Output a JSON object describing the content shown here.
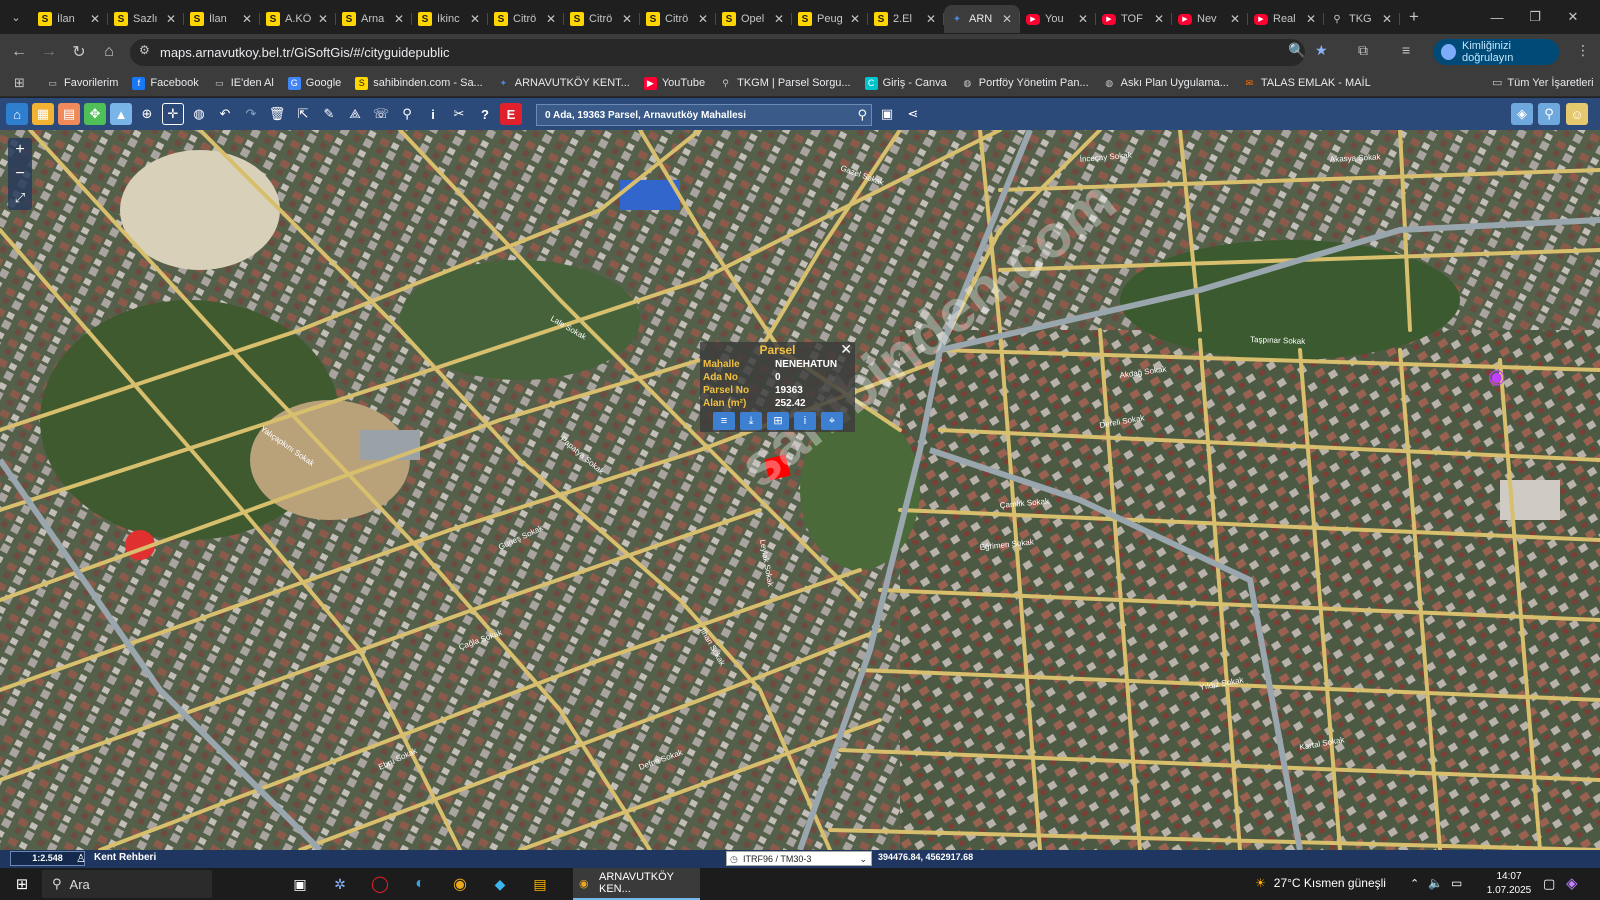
{
  "browser": {
    "tabs": [
      {
        "title": "İlan",
        "favicon": "sahibinden-icon"
      },
      {
        "title": "Sazlı",
        "favicon": "sahibinden-icon"
      },
      {
        "title": "İlan",
        "favicon": "sahibinden-icon"
      },
      {
        "title": "A.KÖ",
        "favicon": "sahibinden-icon"
      },
      {
        "title": "Arna",
        "favicon": "sahibinden-icon"
      },
      {
        "title": "İkinc",
        "favicon": "sahibinden-icon"
      },
      {
        "title": "Citrö",
        "favicon": "sahibinden-icon"
      },
      {
        "title": "Citrö",
        "favicon": "sahibinden-icon"
      },
      {
        "title": "Citrö",
        "favicon": "sahibinden-icon"
      },
      {
        "title": "Opel",
        "favicon": "sahibinden-icon"
      },
      {
        "title": "Peug",
        "favicon": "sahibinden-icon"
      },
      {
        "title": "2.El",
        "favicon": "sahibinden-icon"
      },
      {
        "title": "ARN",
        "favicon": "arnavutkoy-icon",
        "active": true
      },
      {
        "title": "You",
        "favicon": "youtube-icon"
      },
      {
        "title": "TOF",
        "favicon": "youtube-icon"
      },
      {
        "title": "Nev",
        "favicon": "youtube-icon"
      },
      {
        "title": "Real",
        "favicon": "youtube-icon"
      },
      {
        "title": "TKG",
        "favicon": "map-pin-icon"
      }
    ],
    "url": "maps.arnavutkoy.bel.tr/GiSoftGis/#/cityguidepublic",
    "profile_label": "Kimliğinizi doğrulayın",
    "bookmarks": [
      {
        "label": "Favorilerim",
        "icon": "folder-icon"
      },
      {
        "label": "Facebook",
        "icon": "facebook-icon"
      },
      {
        "label": "IE'den Al",
        "icon": "folder-icon"
      },
      {
        "label": "Google",
        "icon": "google-icon"
      },
      {
        "label": "sahibinden.com - Sa...",
        "icon": "sahibinden-icon"
      },
      {
        "label": "ARNAVUTKÖY KENT...",
        "icon": "arnavutkoy-icon"
      },
      {
        "label": "YouTube",
        "icon": "youtube-icon"
      },
      {
        "label": "TKGM | Parsel Sorgu...",
        "icon": "map-pin-icon"
      },
      {
        "label": "Giriş - Canva",
        "icon": "canva-icon"
      },
      {
        "label": "Portföy Yönetim Pan...",
        "icon": "globe-icon"
      },
      {
        "label": "Askı Plan Uygulama...",
        "icon": "globe-icon"
      },
      {
        "label": "TALAS EMLAK - MAİL",
        "icon": "mail-icon"
      }
    ],
    "all_bookmarks_label": "Tüm Yer İşaretleri"
  },
  "map_app": {
    "search_value": "0 Ada, 19363 Parsel, Arnavutköy Mahallesi",
    "parcel_popup": {
      "title": "Parsel",
      "rows": [
        {
          "key": "Mahalle",
          "value": "NENEHATUN"
        },
        {
          "key": "Ada No",
          "value": "0"
        },
        {
          "key": "Parsel No",
          "value": "19363"
        },
        {
          "key": "Alan (m²)",
          "value": "252.42"
        }
      ]
    },
    "scale": "1:2.548",
    "kent_label": "Kent Rehberi",
    "projection": "ITRF96 / TM30-3",
    "coordinates": "394476.84, 4562917.68",
    "watermark": "sahibinden.com",
    "streets": [
      "İnceçay Sokak",
      "Akasya Sokak",
      "Taşpınar Sokak",
      "Akdağ Sokak",
      "Dereli Sokak",
      "Çamlık Sokak",
      "Eğrimen Sokak",
      "Gazel Sokak",
      "Lale Sokak",
      "Yalıçapkını Sokak",
      "Papatya Sokak",
      "Leylak Sokak",
      "Ilhan Sokak",
      "Güneş Sokak",
      "Çağla Sokak",
      "Yıldız Sokak",
      "Kartal Sokak",
      "Ebru Sokak",
      "Defne Sokak"
    ],
    "colors": {
      "toolbar": "#2b4a7a",
      "status": "#1f3660",
      "road": "#d7bf6e",
      "popup_key": "#f0c040"
    }
  },
  "taskbar": {
    "search_placeholder": "Ara",
    "active_app_label": "ARNAVUTKÖY KEN...",
    "weather": "27°C  Kısmen güneşli",
    "time": "14:07",
    "date": "1.07.2025"
  }
}
